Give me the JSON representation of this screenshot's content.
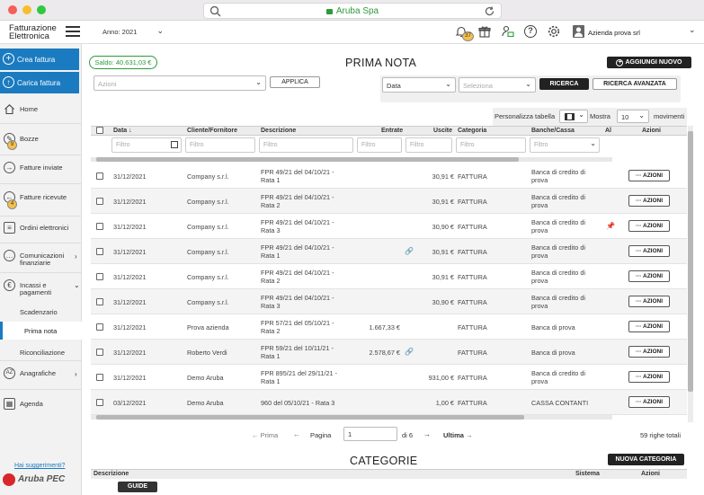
{
  "browser": {
    "url": "Aruba Spa"
  },
  "app": {
    "logo_line1": "Fatturazione",
    "logo_line2": "Elettronica",
    "year_label": "Anno: 2021",
    "notification_count": "37",
    "company": "Azienda prova srl"
  },
  "sidebar": {
    "create_invoice": "Crea fattura",
    "upload_invoice": "Carica fattura",
    "items": [
      {
        "label": "Home"
      },
      {
        "label": "Bozze",
        "badge": "9"
      },
      {
        "label": "Fatture inviate"
      },
      {
        "label": "Fatture ricevute",
        "badge": "4"
      },
      {
        "label": "Ordini elettronici"
      },
      {
        "label_line1": "Comunicazioni",
        "label_line2": "finanziarie"
      },
      {
        "label_line1": "Incassi e",
        "label_line2": "pagamenti"
      }
    ],
    "sub_items": [
      "Scadenzario",
      "Prima nota",
      "Riconciliazione"
    ],
    "items2": [
      {
        "label": "Anagrafiche"
      },
      {
        "label": "Agenda"
      }
    ],
    "suggestions": "Hai suggerimenti?",
    "brand": "Aruba PEC"
  },
  "header": {
    "saldo": "Saldo: 40.631,03 €",
    "title": "PRIMA NOTA",
    "add_new": "AGGIUNGI NUOVO"
  },
  "actions_bar": {
    "actions_placeholder": "Azioni",
    "apply": "APPLICA",
    "date_select": "Data",
    "date_value_placeholder": "Seleziona",
    "search": "RICERCA",
    "advanced_search": "RICERCA AVANZATA"
  },
  "table_controls": {
    "customize": "Personalizza tabella",
    "show": "Mostra",
    "page_size": "10",
    "movements": "movimenti"
  },
  "columns": {
    "date": "Data ↓",
    "client": "Cliente/Fornitore",
    "description": "Descrizione",
    "income": "Entrate",
    "expense": "Uscite",
    "category": "Categoria",
    "bank": "Banche/Cassa",
    "al": "Al",
    "actions": "Azioni"
  },
  "filter_placeholder": "Filtro",
  "action_button": "··· AZIONI",
  "rows": [
    {
      "date": "31/12/2021",
      "client": "Company s.r.l.",
      "desc1": "FPR 49/21 del 04/10/21 -",
      "desc2": "Rata 1",
      "income": "",
      "expense": "30,91 €",
      "category": "FATTURA",
      "bank1": "Banca di credito di",
      "bank2": "prova",
      "link": false,
      "pin": false
    },
    {
      "date": "31/12/2021",
      "client": "Company s.r.l.",
      "desc1": "FPR 49/21 del 04/10/21 -",
      "desc2": "Rata 2",
      "income": "",
      "expense": "30,91 €",
      "category": "FATTURA",
      "bank1": "Banca di credito di",
      "bank2": "prova",
      "link": false,
      "pin": false
    },
    {
      "date": "31/12/2021",
      "client": "Company s.r.l.",
      "desc1": "FPR 49/21 del 04/10/21 -",
      "desc2": "Rata 3",
      "income": "",
      "expense": "30,90 €",
      "category": "FATTURA",
      "bank1": "Banca di credito di",
      "bank2": "prova",
      "link": false,
      "pin": true
    },
    {
      "date": "31/12/2021",
      "client": "Company s.r.l.",
      "desc1": "FPR 49/21 del 04/10/21 -",
      "desc2": "Rata 1",
      "income": "",
      "expense": "30,91 €",
      "category": "FATTURA",
      "bank1": "Banca di credito di",
      "bank2": "prova",
      "link": true,
      "pin": false
    },
    {
      "date": "31/12/2021",
      "client": "Company s.r.l.",
      "desc1": "FPR 49/21 del 04/10/21 -",
      "desc2": "Rata 2",
      "income": "",
      "expense": "30,91 €",
      "category": "FATTURA",
      "bank1": "Banca di credito di",
      "bank2": "prova",
      "link": false,
      "pin": false
    },
    {
      "date": "31/12/2021",
      "client": "Company s.r.l.",
      "desc1": "FPR 49/21 del 04/10/21 -",
      "desc2": "Rata 3",
      "income": "",
      "expense": "30,90 €",
      "category": "FATTURA",
      "bank1": "Banca di credito di",
      "bank2": "prova",
      "link": false,
      "pin": false
    },
    {
      "date": "31/12/2021",
      "client": "Prova azienda",
      "desc1": "FPR 57/21 del 05/10/21 -",
      "desc2": "Rata 2",
      "income": "1.667,33 €",
      "expense": "",
      "category": "FATTURA",
      "bank1": "Banca di prova",
      "bank2": "",
      "link": false,
      "pin": false
    },
    {
      "date": "31/12/2021",
      "client": "Roberto Verdi",
      "desc1": "FPR 59/21 del 10/11/21 -",
      "desc2": "Rata 1",
      "income": "2.578,67 €",
      "expense": "",
      "category": "FATTURA",
      "bank1": "Banca di prova",
      "bank2": "",
      "link": true,
      "pin": false
    },
    {
      "date": "31/12/2021",
      "client": "Demo Aruba",
      "desc1": "FPR 895/21 del 29/11/21 -",
      "desc2": "Rata 1",
      "income": "",
      "expense": "931,00 €",
      "category": "FATTURA",
      "bank1": "Banca di credito di",
      "bank2": "prova",
      "link": false,
      "pin": false
    },
    {
      "date": "03/12/2021",
      "client": "Demo Aruba",
      "desc1": "960 del 05/10/21 - Rata 3",
      "desc2": "",
      "income": "",
      "expense": "1,00 €",
      "category": "FATTURA",
      "bank1": "CASSA CONTANTI",
      "bank2": "",
      "link": false,
      "pin": false
    }
  ],
  "pagination": {
    "first": "← Prima",
    "prev": "←",
    "page_label": "Pagina",
    "page_value": "1",
    "of": "di 6",
    "next": "→",
    "last": "Ultima →",
    "total": "59 righe totali"
  },
  "categories": {
    "title": "CATEGORIE",
    "new_category": "NUOVA CATEGORIA",
    "col_description": "Descrizione",
    "col_system": "Sistema",
    "col_actions": "Azioni"
  },
  "guide": "GUIDE",
  "colors": {
    "primary": "#1b7bc0",
    "dark": "#222222",
    "saldo_green": "#2e9a3a"
  }
}
